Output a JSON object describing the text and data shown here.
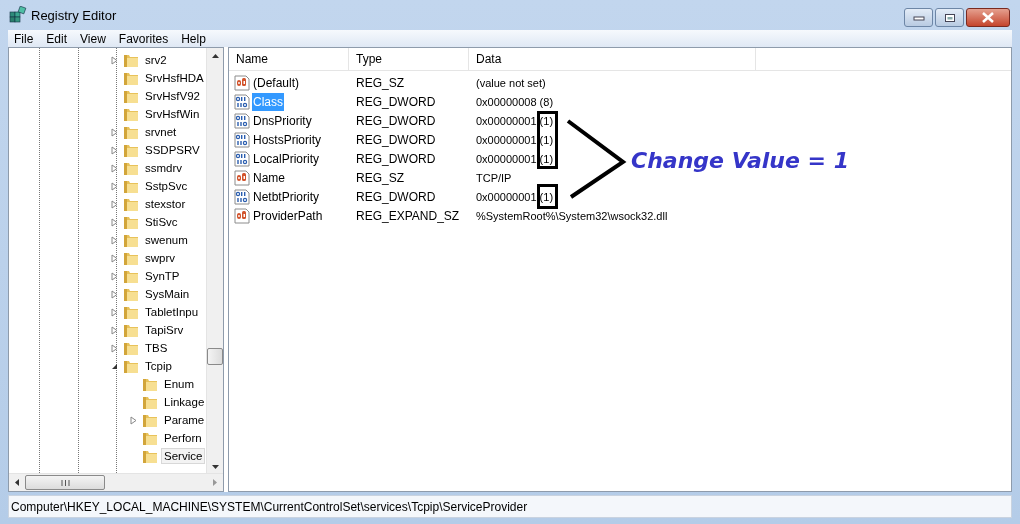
{
  "window": {
    "title": "Registry Editor"
  },
  "menu": [
    "File",
    "Edit",
    "View",
    "Favorites",
    "Help"
  ],
  "tree": [
    {
      "name": "srv2",
      "expanded": false,
      "selected": false
    },
    {
      "name": "SrvHsfHDA",
      "selected": false
    },
    {
      "name": "SrvHsfV92",
      "selected": false
    },
    {
      "name": "SrvHsfWin",
      "selected": false
    },
    {
      "name": "srvnet",
      "expanded": false,
      "selected": false
    },
    {
      "name": "SSDPSRV",
      "expanded": false,
      "selected": false
    },
    {
      "name": "ssmdrv",
      "expanded": false,
      "selected": false
    },
    {
      "name": "SstpSvc",
      "expanded": false,
      "selected": false
    },
    {
      "name": "stexstor",
      "expanded": false,
      "selected": false
    },
    {
      "name": "StiSvc",
      "expanded": false,
      "selected": false
    },
    {
      "name": "swenum",
      "expanded": false,
      "selected": false
    },
    {
      "name": "swprv",
      "expanded": false,
      "selected": false
    },
    {
      "name": "SynTP",
      "expanded": false,
      "selected": false
    },
    {
      "name": "SysMain",
      "expanded": false,
      "selected": false
    },
    {
      "name": "TabletInpu",
      "expanded": false,
      "selected": false
    },
    {
      "name": "TapiSrv",
      "expanded": false,
      "selected": false
    },
    {
      "name": "TBS",
      "expanded": false,
      "selected": false
    },
    {
      "name": "Tcpip",
      "expanded": true,
      "selected": false,
      "children": [
        {
          "name": "Enum",
          "selected": false
        },
        {
          "name": "Linkage",
          "selected": false
        },
        {
          "name": "Parame",
          "expanded": false,
          "selected": false
        },
        {
          "name": "Perforn",
          "selected": false
        },
        {
          "name": "Service",
          "selected": true
        }
      ]
    }
  ],
  "columns": [
    "Name",
    "Type",
    "Data"
  ],
  "values": [
    {
      "kind": "string",
      "name": "(Default)",
      "type": "REG_SZ",
      "data": "(value not set)",
      "selected": false
    },
    {
      "kind": "binary",
      "name": "Class",
      "type": "REG_DWORD",
      "data": "0x00000008 (8)",
      "selected": true
    },
    {
      "kind": "binary",
      "name": "DnsPriority",
      "type": "REG_DWORD",
      "data": "0x00000001 (1)",
      "selected": false
    },
    {
      "kind": "binary",
      "name": "HostsPriority",
      "type": "REG_DWORD",
      "data": "0x00000001 (1)",
      "selected": false
    },
    {
      "kind": "binary",
      "name": "LocalPriority",
      "type": "REG_DWORD",
      "data": "0x00000001 (1)",
      "selected": false
    },
    {
      "kind": "string",
      "name": "Name",
      "type": "REG_SZ",
      "data": "TCP/IP",
      "selected": false
    },
    {
      "kind": "binary",
      "name": "NetbtPriority",
      "type": "REG_DWORD",
      "data": "0x00000001 (1)",
      "selected": false
    },
    {
      "kind": "string",
      "name": "ProviderPath",
      "type": "REG_EXPAND_SZ",
      "data": "%SystemRoot%\\System32\\wsock32.dll",
      "selected": false
    }
  ],
  "annotation": {
    "text": "Change Value = 1"
  },
  "status_bar": "Computer\\HKEY_LOCAL_MACHINE\\SYSTEM\\CurrentControlSet\\services\\Tcpip\\ServiceProvider"
}
